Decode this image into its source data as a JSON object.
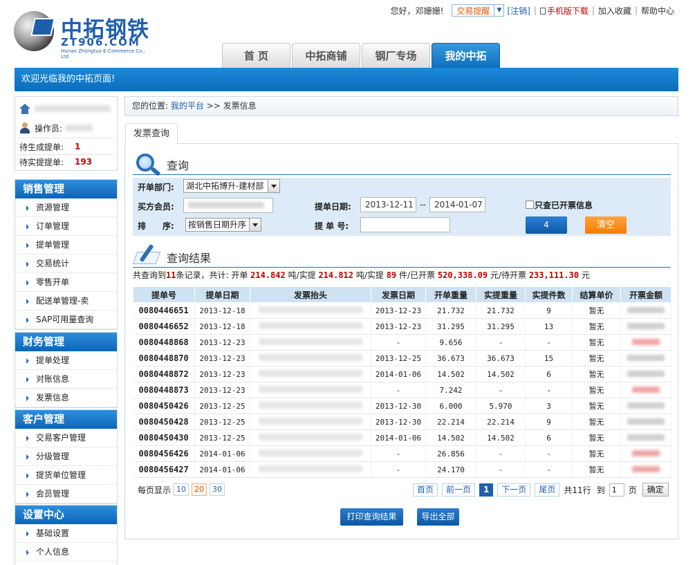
{
  "logo": {
    "name": "中拓钢铁",
    "url": "ZT906.COM",
    "sub": "Hunan Zhongtuo E-Commerce Co., Ltd"
  },
  "toplinks": {
    "greeting": "您好，邓姗姗!",
    "trade_alert": "交易提醒",
    "logout": "[注销]",
    "mobile": "手机版下载",
    "favorite": "加入收藏",
    "help": "帮助中心"
  },
  "nav": {
    "tabs": [
      "首 页",
      "中拓商铺",
      "钢厂专场",
      "我的中拓"
    ],
    "active": 3
  },
  "welcome": "欢迎光临我的中拓页面!",
  "user": {
    "operator_label": "操作员:",
    "stats": [
      {
        "label": "待生成提单:",
        "value": "1"
      },
      {
        "label": "待实提提单:",
        "value": "193"
      }
    ]
  },
  "sidebar": [
    {
      "title": "销售管理",
      "items": [
        "资源管理",
        "订单管理",
        "提单管理",
        "交易统计",
        "零售开单",
        "配送单管理-卖",
        "SAP可用量查询"
      ]
    },
    {
      "title": "财务管理",
      "items": [
        "提单处理",
        "对账信息",
        "发票信息"
      ]
    },
    {
      "title": "客户管理",
      "items": [
        "交易客户管理",
        "分级管理",
        "提货单位管理",
        "会员管理"
      ]
    },
    {
      "title": "设置中心",
      "items": [
        "基础设置",
        "个人信息"
      ]
    }
  ],
  "breadcrumb": {
    "prefix": "您的位置:",
    "link": "我的平台",
    "sep": ">>",
    "current": "发票信息"
  },
  "subtab": "发票查询",
  "query": {
    "title": "查询",
    "dept_label": "开单部门:",
    "dept_value": "湖北中拓博升-建材部",
    "buyer_label": "买方会员:",
    "sort_label": "排　　序:",
    "sort_value": "按销售日期升序",
    "date_label": "提单日期:",
    "date_from": "2013-12-11",
    "date_sep": "--",
    "date_to": "2014-01-07",
    "billno_label": "提 单 号:",
    "billno_value": "",
    "only_invoiced_label": "只查已开票信息",
    "search_btn": "4",
    "clear_btn": "清空"
  },
  "results": {
    "title": "查询结果",
    "summary": {
      "p1": "共查询到",
      "count": "11",
      "p2": "条记录，共计:  开单",
      "open_weight": "214.842",
      "p3": "吨/实提",
      "actual_weight": "214.812",
      "p4": "吨/实提",
      "actual_pieces": "89",
      "p5": "件/已开票",
      "invoiced": "520,338.09",
      "p6": "元/待开票",
      "pending": "233,111.30",
      "p7": "元"
    },
    "columns": [
      "提单号",
      "提单日期",
      "发票抬头",
      "发票日期",
      "开单重量",
      "实提重量",
      "实提件数",
      "结算单价",
      "开票金额"
    ],
    "rows": [
      {
        "id": "0080446651",
        "date": "2013-12-18",
        "inv_date": "2013-12-23",
        "open_w": "21.732",
        "act_w": "21.732",
        "pcs": "9",
        "price": "暂无",
        "amt": "dark"
      },
      {
        "id": "0080446652",
        "date": "2013-12-18",
        "inv_date": "2013-12-23",
        "open_w": "31.295",
        "act_w": "31.295",
        "pcs": "13",
        "price": "暂无",
        "amt": "dark"
      },
      {
        "id": "0080448868",
        "date": "2013-12-23",
        "inv_date": "-",
        "open_w": "9.656",
        "act_w": "-",
        "pcs": "-",
        "price": "暂无",
        "amt": "red"
      },
      {
        "id": "0080448870",
        "date": "2013-12-23",
        "inv_date": "2013-12-25",
        "open_w": "36.673",
        "act_w": "36.673",
        "pcs": "15",
        "price": "暂无",
        "amt": "dark"
      },
      {
        "id": "0080448872",
        "date": "2013-12-23",
        "inv_date": "2014-01-06",
        "open_w": "14.502",
        "act_w": "14.502",
        "pcs": "6",
        "price": "暂无",
        "amt": "dark"
      },
      {
        "id": "0080448873",
        "date": "2013-12-23",
        "inv_date": "-",
        "open_w": "7.242",
        "act_w": "-",
        "pcs": "-",
        "price": "暂无",
        "amt": "red"
      },
      {
        "id": "0080450426",
        "date": "2013-12-25",
        "inv_date": "2013-12-30",
        "open_w": "6.000",
        "act_w": "5.970",
        "pcs": "3",
        "price": "暂无",
        "amt": "dark"
      },
      {
        "id": "0080450428",
        "date": "2013-12-25",
        "inv_date": "2013-12-30",
        "open_w": "22.214",
        "act_w": "22.214",
        "pcs": "9",
        "price": "暂无",
        "amt": "dark"
      },
      {
        "id": "0080450430",
        "date": "2013-12-25",
        "inv_date": "2014-01-06",
        "open_w": "14.502",
        "act_w": "14.502",
        "pcs": "6",
        "price": "暂无",
        "amt": "dark"
      },
      {
        "id": "0080456426",
        "date": "2014-01-06",
        "inv_date": "-",
        "open_w": "26.856",
        "act_w": "-",
        "pcs": "-",
        "price": "暂无",
        "amt": "red"
      },
      {
        "id": "0080456427",
        "date": "2014-01-06",
        "inv_date": "-",
        "open_w": "24.170",
        "act_w": "-",
        "pcs": "-",
        "price": "暂无",
        "amt": "red"
      }
    ]
  },
  "pager": {
    "per_page_label": "每页显示",
    "sizes": [
      "10",
      "20",
      "30"
    ],
    "selected_size": "20",
    "first": "首页",
    "prev": "前一页",
    "current": "1",
    "next": "下一页",
    "last": "尾页",
    "total": "共11行",
    "goto_label": "到",
    "goto_value": "1",
    "page_unit": "页",
    "confirm": "确定"
  },
  "actions": {
    "print": "打印查询结果",
    "export": "导出全部"
  }
}
